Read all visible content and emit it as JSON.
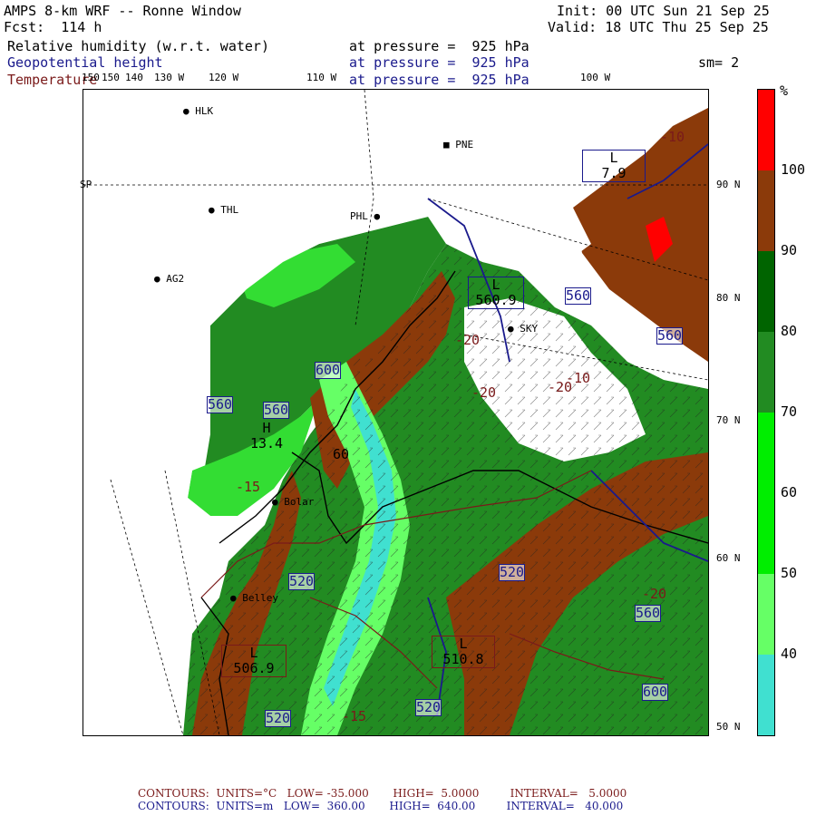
{
  "header": {
    "title": "AMPS 8-km WRF -- Ronne Window",
    "init": "Init: 00 UTC Sun 21 Sep 25",
    "forecast": "Fcst:  114 h",
    "valid": "Valid: 18 UTC Thu 25 Sep 25"
  },
  "fields": [
    {
      "name": "Relative humidity (w.r.t. water)",
      "level": "at pressure =  925 hPa",
      "color": "#000000"
    },
    {
      "name": "Geopotential height",
      "level": "at pressure =  925 hPa",
      "color": "#1a1a8c"
    },
    {
      "name": "Temperature",
      "level": "at pressure =  925 hPa",
      "color": "#7a1a1a"
    }
  ],
  "smoothing": "sm= 2",
  "top_axis_labels": [
    "150",
    "150",
    "140",
    "130 W",
    "120 W",
    "110 W",
    "100 W"
  ],
  "right_axis_labels": [
    "90 N",
    "80 N",
    "70 N",
    "60 N",
    "50 N"
  ],
  "left_axis_label": "SP",
  "stations": [
    {
      "label": "HLK"
    },
    {
      "label": "PNE"
    },
    {
      "label": "THL"
    },
    {
      "label": "PHL"
    },
    {
      "label": "AG2"
    },
    {
      "label": "SKY"
    },
    {
      "label": "Bolar"
    },
    {
      "label": "Belley"
    }
  ],
  "contour_labels": {
    "height": [
      "560",
      "560",
      "600",
      "560",
      "520",
      "520",
      "560",
      "600",
      "520",
      "520",
      "560"
    ],
    "temperature": [
      "-20",
      "-10",
      "-20",
      "-15",
      "-20",
      "-15",
      "-20",
      "-10"
    ],
    "lows": [
      {
        "letter": "L",
        "value": "506.9"
      },
      {
        "letter": "L",
        "value": "510.8"
      },
      {
        "letter": "H",
        "value": "13.4"
      },
      {
        "letter": "L",
        "value": "560.9"
      },
      {
        "letter": "L",
        "value": "7.9"
      }
    ],
    "other": [
      "60"
    ]
  },
  "colorbar": {
    "unit": "%",
    "levels": [
      "100",
      "90",
      "80",
      "70",
      "60",
      "50",
      "40"
    ],
    "colors": [
      "#ff0000",
      "#8b3a0a",
      "#006400",
      "#228b22",
      "#00ee00",
      "#66ff66",
      "#40e0d0"
    ]
  },
  "footer": {
    "temp_line": "CONTOURS:  UNITS=°C   LOW= -35.000       HIGH=  5.0000         INTERVAL=   5.0000",
    "height_line": "CONTOURS:  UNITS=m   LOW=  360.00       HIGH=  640.00         INTERVAL=   40.000",
    "temp_color": "#7a1a1a",
    "height_color": "#1a1a8c"
  }
}
